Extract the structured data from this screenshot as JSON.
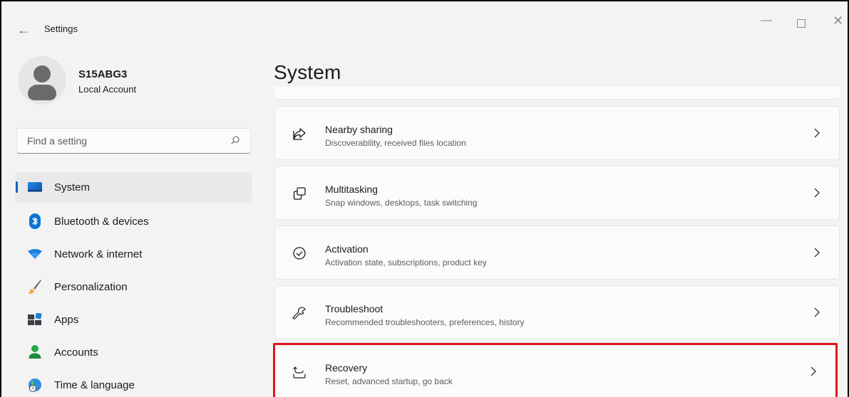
{
  "window": {
    "title": "Settings",
    "back_icon": "back-arrow-icon",
    "controls": [
      "minimize-icon",
      "maximize-icon",
      "close-icon"
    ]
  },
  "profile": {
    "name": "S15ABG3",
    "account_type": "Local Account",
    "avatar_icon": "user-avatar-icon"
  },
  "search": {
    "placeholder": "Find a setting",
    "value": "",
    "icon": "search-icon"
  },
  "sidebar": {
    "items": [
      {
        "label": "System",
        "icon": "system-display-icon",
        "active": true
      },
      {
        "label": "Bluetooth & devices",
        "icon": "bluetooth-icon",
        "active": false
      },
      {
        "label": "Network & internet",
        "icon": "wifi-icon",
        "active": false
      },
      {
        "label": "Personalization",
        "icon": "brush-icon",
        "active": false
      },
      {
        "label": "Apps",
        "icon": "apps-icon",
        "active": false
      },
      {
        "label": "Accounts",
        "icon": "accounts-icon",
        "active": false
      },
      {
        "label": "Time & language",
        "icon": "globe-clock-icon",
        "active": false
      }
    ]
  },
  "main": {
    "title": "System",
    "cards": [
      {
        "title": "Nearby sharing",
        "description": "Discoverability, received files location",
        "icon": "share-icon"
      },
      {
        "title": "Multitasking",
        "description": "Snap windows, desktops, task switching",
        "icon": "multitasking-icon"
      },
      {
        "title": "Activation",
        "description": "Activation state, subscriptions, product key",
        "icon": "check-circle-icon"
      },
      {
        "title": "Troubleshoot",
        "description": "Recommended troubleshooters, preferences, history",
        "icon": "wrench-icon"
      },
      {
        "title": "Recovery",
        "description": "Reset, advanced startup, go back",
        "icon": "recovery-icon",
        "highlighted": true
      }
    ]
  },
  "colors": {
    "accent": "#0067c0",
    "highlight_border": "#e0141e",
    "background": "#f3f3f3",
    "card": "#fbfbfb"
  }
}
